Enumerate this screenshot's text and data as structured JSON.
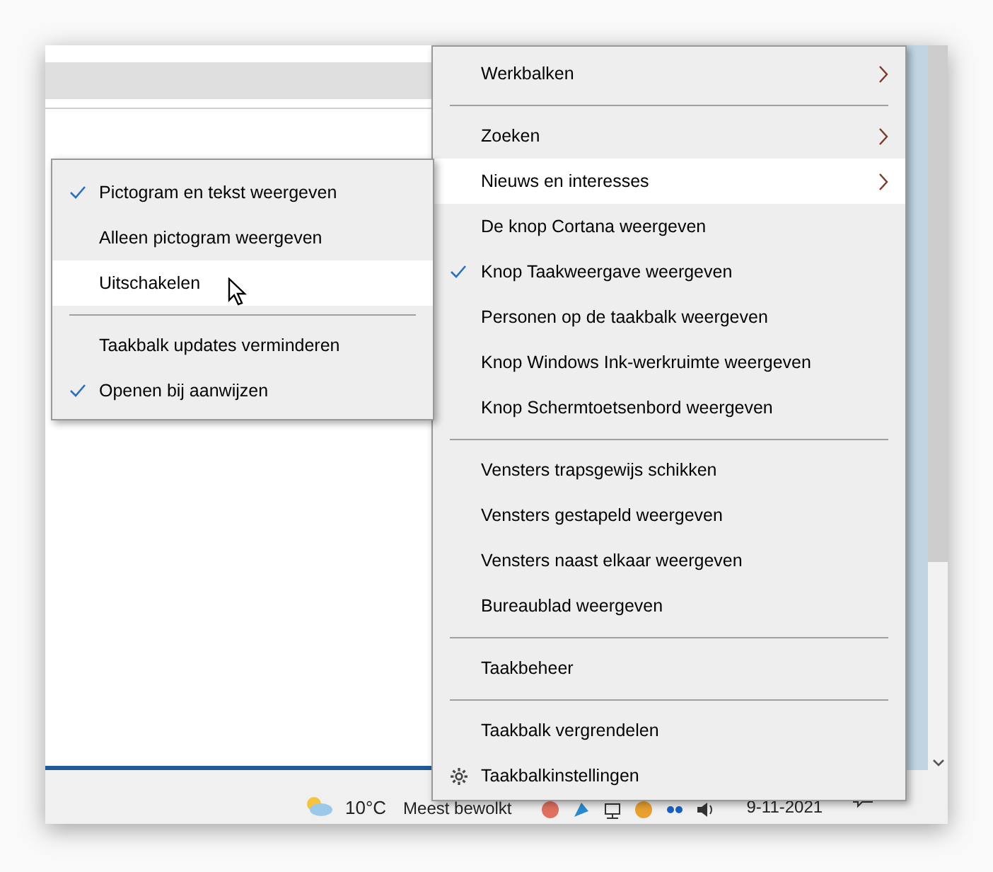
{
  "main_menu": {
    "items": [
      {
        "kind": "item",
        "label": "Werkbalken",
        "checked": false,
        "selected": false,
        "submenu": true
      },
      {
        "kind": "separator"
      },
      {
        "kind": "item",
        "label": "Zoeken",
        "checked": false,
        "selected": false,
        "submenu": true
      },
      {
        "kind": "item",
        "label": "Nieuws en interesses",
        "checked": false,
        "selected": true,
        "submenu": true
      },
      {
        "kind": "item",
        "label": "De knop Cortana weergeven",
        "checked": false,
        "selected": false,
        "submenu": false
      },
      {
        "kind": "item",
        "label": "Knop Taakweergave weergeven",
        "checked": true,
        "selected": false,
        "submenu": false
      },
      {
        "kind": "item",
        "label": "Personen op de taakbalk weergeven",
        "checked": false,
        "selected": false,
        "submenu": false
      },
      {
        "kind": "item",
        "label": "Knop Windows Ink-werkruimte weergeven",
        "checked": false,
        "selected": false,
        "submenu": false
      },
      {
        "kind": "item",
        "label": "Knop Schermtoetsenbord weergeven",
        "checked": false,
        "selected": false,
        "submenu": false
      },
      {
        "kind": "separator"
      },
      {
        "kind": "item",
        "label": "Vensters trapsgewijs schikken",
        "checked": false,
        "selected": false,
        "submenu": false
      },
      {
        "kind": "item",
        "label": "Vensters gestapeld weergeven",
        "checked": false,
        "selected": false,
        "submenu": false
      },
      {
        "kind": "item",
        "label": "Vensters naast elkaar weergeven",
        "checked": false,
        "selected": false,
        "submenu": false
      },
      {
        "kind": "item",
        "label": "Bureaublad weergeven",
        "checked": false,
        "selected": false,
        "submenu": false
      },
      {
        "kind": "separator"
      },
      {
        "kind": "item",
        "label": "Taakbeheer",
        "checked": false,
        "selected": false,
        "submenu": false
      },
      {
        "kind": "separator"
      },
      {
        "kind": "item",
        "label": "Taakbalk vergrendelen",
        "checked": false,
        "selected": false,
        "submenu": false
      },
      {
        "kind": "settings",
        "label": "Taakbalkinstellingen",
        "checked": false,
        "selected": false,
        "submenu": false
      }
    ]
  },
  "submenu": {
    "items": [
      {
        "kind": "item",
        "label": "Pictogram en tekst weergeven",
        "checked": true,
        "selected": false,
        "submenu": false
      },
      {
        "kind": "item",
        "label": "Alleen pictogram weergeven",
        "checked": false,
        "selected": false,
        "submenu": false
      },
      {
        "kind": "item",
        "label": "Uitschakelen",
        "checked": false,
        "selected": true,
        "submenu": false
      },
      {
        "kind": "separator"
      },
      {
        "kind": "item",
        "label": "Taakbalk updates verminderen",
        "checked": false,
        "selected": false,
        "submenu": false
      },
      {
        "kind": "item",
        "label": "Openen bij aanwijzen",
        "checked": true,
        "selected": false,
        "submenu": false
      }
    ]
  },
  "taskbar": {
    "temperature": "10°C",
    "weather": "Meest bewolkt",
    "date": "9-11-2021"
  }
}
